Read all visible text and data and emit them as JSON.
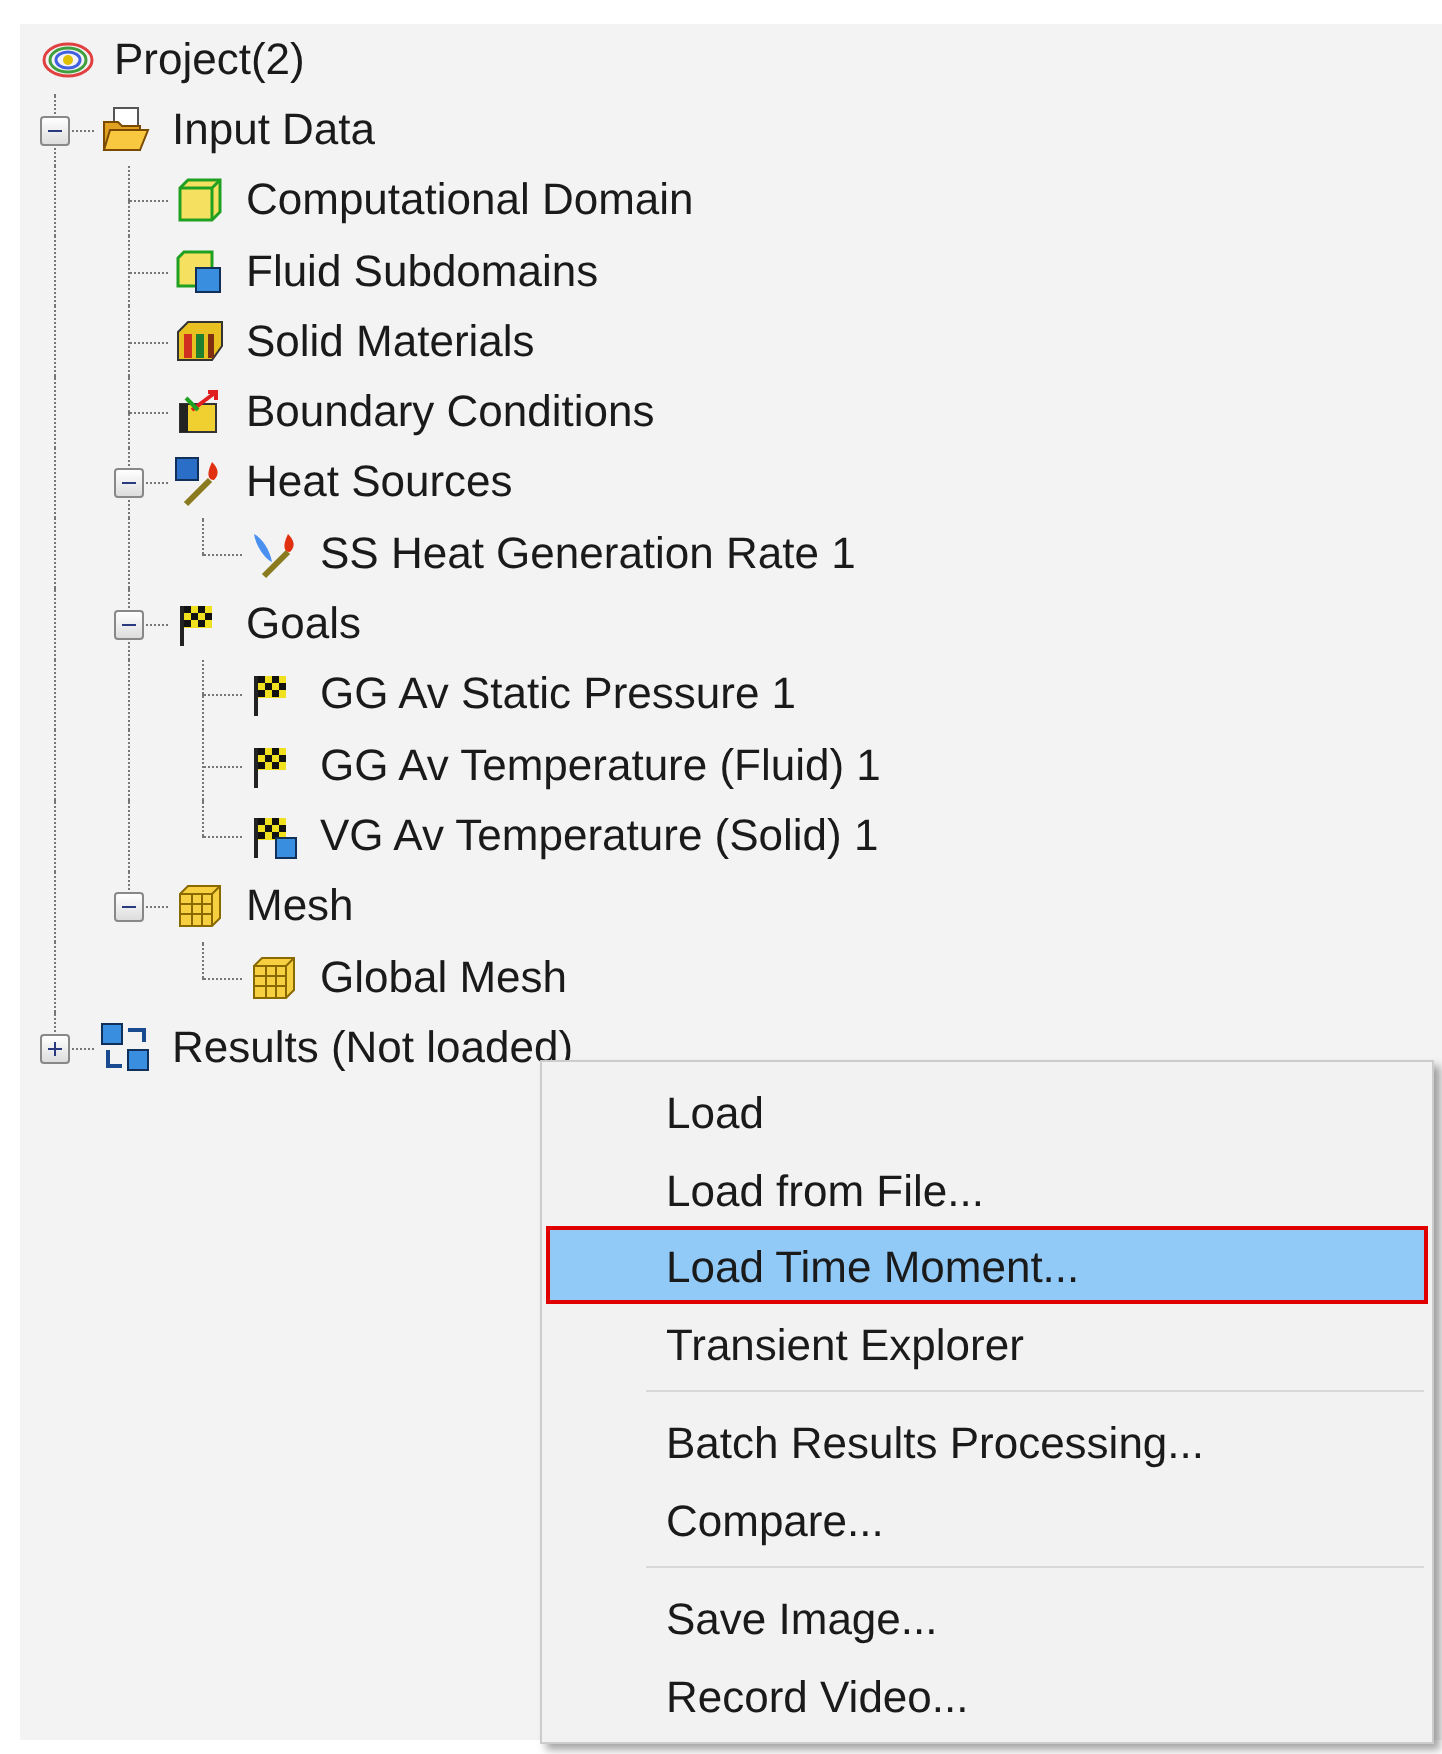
{
  "tree": [
    {
      "label": "Project(2)",
      "kind": "project",
      "children": [
        {
          "label": "Input Data",
          "kind": "folder",
          "expanded": true,
          "children": [
            {
              "label": "Computational Domain",
              "kind": "domain"
            },
            {
              "label": "Fluid Subdomains",
              "kind": "subdomain"
            },
            {
              "label": "Solid Materials",
              "kind": "materials"
            },
            {
              "label": "Boundary Conditions",
              "kind": "boundary"
            },
            {
              "label": "Heat Sources",
              "kind": "heat",
              "expanded": true,
              "children": [
                {
                  "label": "SS Heat Generation Rate 1",
                  "kind": "heat-source"
                }
              ]
            },
            {
              "label": "Goals",
              "kind": "goal",
              "expanded": true,
              "children": [
                {
                  "label": "GG Av Static Pressure 1",
                  "kind": "goal"
                },
                {
                  "label": "GG Av Temperature (Fluid) 1",
                  "kind": "goal"
                },
                {
                  "label": "VG Av Temperature (Solid) 1",
                  "kind": "goal-volume"
                }
              ]
            },
            {
              "label": "Mesh",
              "kind": "mesh",
              "expanded": true,
              "children": [
                {
                  "label": "Global Mesh",
                  "kind": "mesh"
                }
              ]
            }
          ]
        },
        {
          "label": "Results (Not loaded)",
          "kind": "results",
          "expanded": false
        }
      ]
    }
  ],
  "context_menu": [
    {
      "kind": "item",
      "label": "Load",
      "selected": false
    },
    {
      "kind": "item",
      "label": "Load from File...",
      "selected": false
    },
    {
      "kind": "item",
      "label": "Load Time Moment...",
      "selected": true
    },
    {
      "kind": "item",
      "label": "Transient Explorer",
      "selected": false
    },
    {
      "kind": "separator"
    },
    {
      "kind": "item",
      "label": "Batch Results Processing...",
      "selected": false
    },
    {
      "kind": "item",
      "label": "Compare...",
      "selected": false
    },
    {
      "kind": "separator"
    },
    {
      "kind": "item",
      "label": "Save Image...",
      "selected": false
    },
    {
      "kind": "item",
      "label": "Record Video...",
      "selected": false
    }
  ]
}
